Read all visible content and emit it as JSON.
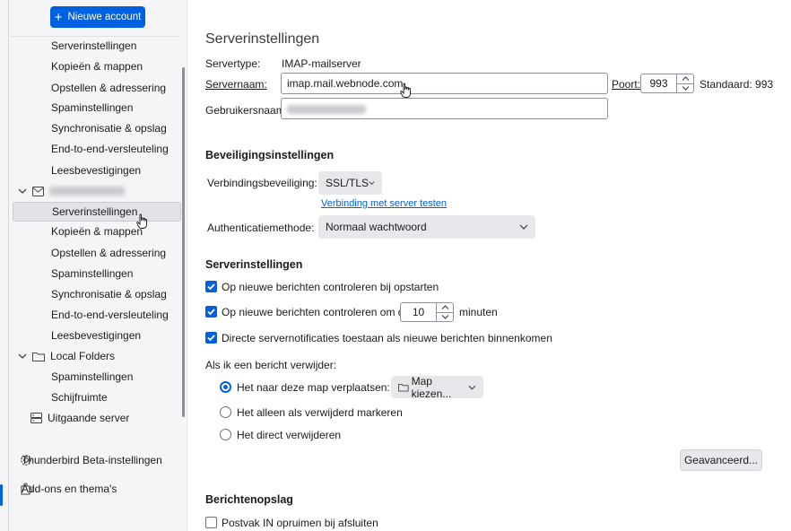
{
  "sidebar": {
    "new_account_label": "Nieuwe account",
    "account1_items": [
      "Serverinstellingen",
      "Kopieën & mappen",
      "Opstellen & adressering",
      "Spaminstellingen",
      "Synchronisatie & opslag",
      "End-to-end-versleuteling",
      "Leesbevestigingen"
    ],
    "account2_items": [
      "Serverinstellingen",
      "Kopieën & mappen",
      "Opstellen & adressering",
      "Spaminstellingen",
      "Synchronisatie & opslag",
      "End-to-end-versleuteling",
      "Leesbevestigingen"
    ],
    "local_folders_label": "Local Folders",
    "local_folders_items": [
      "Spaminstellingen",
      "Schijfruimte"
    ],
    "outgoing_server_label": "Uitgaande server",
    "beta_settings_label": "Thunderbird Beta-instellingen",
    "addons_label": "Add-ons en thema's"
  },
  "main": {
    "title": "Serverinstellingen",
    "servertype_label": "Servertype:",
    "servertype_value": "IMAP-mailserver",
    "servername_label": "Servernaam:",
    "servername_value": "imap.mail.webnode.com",
    "port_label": "Poort:",
    "port_value": "993",
    "default_label": "Standaard: 993",
    "username_label": "Gebruikersnaam:",
    "security_heading": "Beveiligingsinstellingen",
    "connection_security_label": "Verbindingsbeveiliging:",
    "connection_security_value": "SSL/TLS",
    "test_link": "Verbinding met server testen",
    "auth_label": "Authenticatiemethode:",
    "auth_value": "Normaal wachtwoord",
    "server_settings_heading": "Serverinstellingen",
    "check_startup_label": "Op nieuwe berichten controleren bij opstarten",
    "check_every_label": "Op nieuwe berichten controleren om de",
    "check_every_value": "10",
    "minutes_label": "minuten",
    "push_label": "Directe servernotificaties toestaan als nieuwe berichten binnenkomen",
    "delete_label": "Als ik een bericht verwijder:",
    "radio_move_label": "Het naar deze map verplaatsen:",
    "choose_folder_label": "Map kiezen...",
    "radio_mark_label": "Het alleen als verwijderd markeren",
    "radio_delete_label": "Het direct verwijderen",
    "advanced_button": "Geavanceerd...",
    "storage_heading": "Berichtenopslag",
    "cleanup_label": "Postvak IN opruimen bij afsluiten"
  }
}
